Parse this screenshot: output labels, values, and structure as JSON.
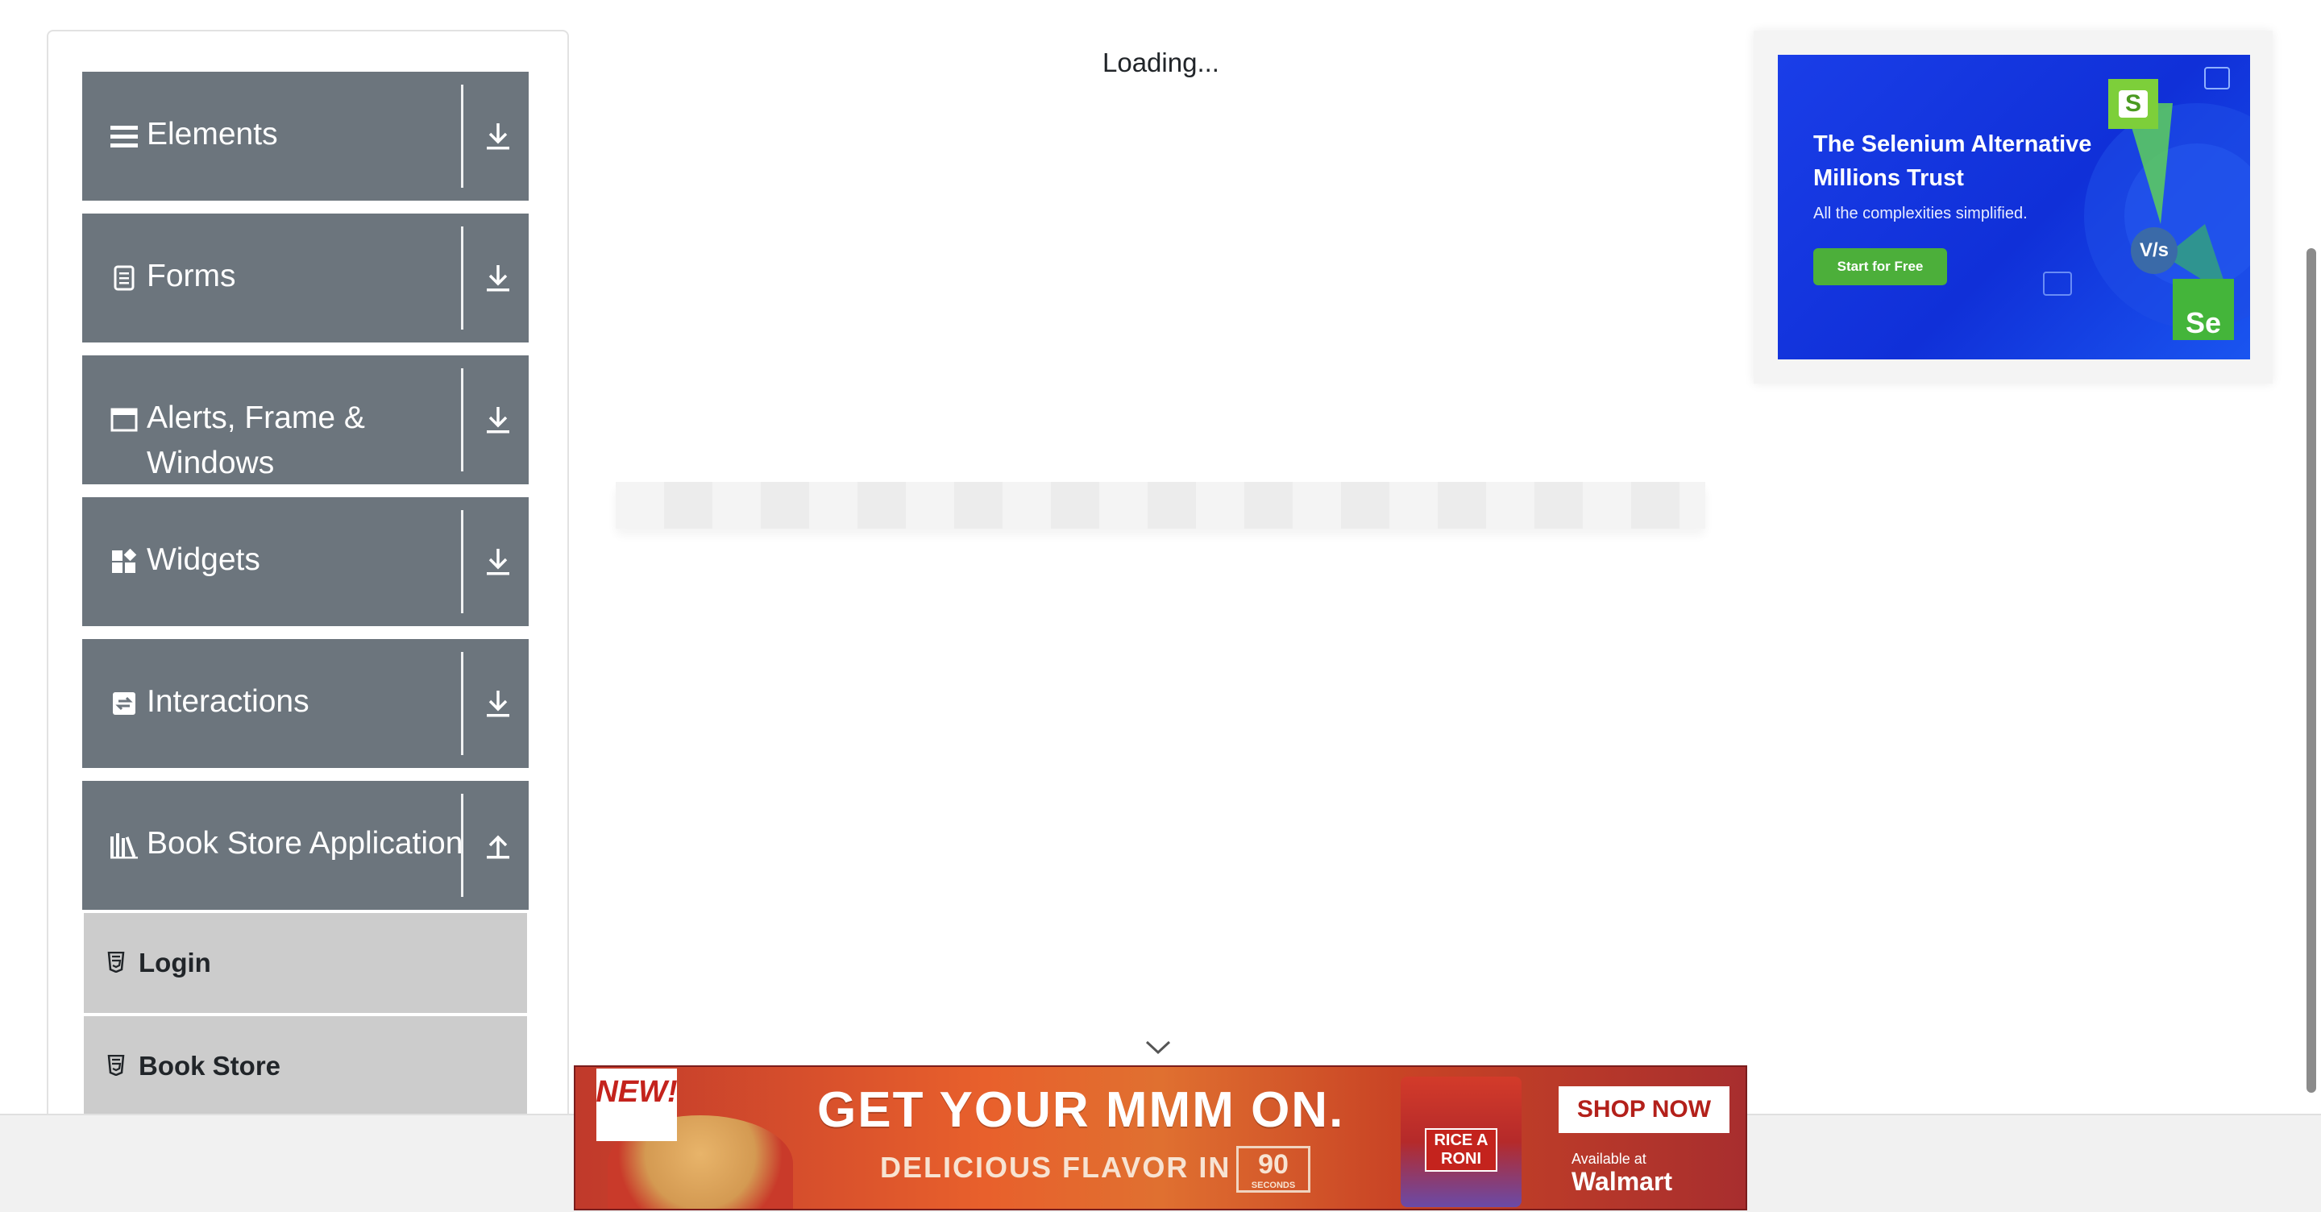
{
  "sidebar": {
    "groups": [
      {
        "title": "Elements",
        "icon": "hamburger-icon",
        "arrow": "download-arrow-icon"
      },
      {
        "title": "Forms",
        "icon": "document-icon",
        "arrow": "download-arrow-icon"
      },
      {
        "title": "Alerts, Frame & Windows",
        "icon": "window-icon",
        "arrow": "download-arrow-icon"
      },
      {
        "title": "Widgets",
        "icon": "widgets-icon",
        "arrow": "download-arrow-icon"
      },
      {
        "title": "Interactions",
        "icon": "interactions-icon",
        "arrow": "download-arrow-icon"
      },
      {
        "title": "Book Store Application",
        "icon": "books-icon",
        "arrow": "upload-arrow-icon"
      }
    ],
    "sub_items": [
      {
        "label": "Login",
        "icon": "html5-icon"
      },
      {
        "label": "Book Store",
        "icon": "html5-icon"
      }
    ]
  },
  "main": {
    "loading_text": "Loading..."
  },
  "right_ad": {
    "headline": "The Selenium Alternative Millions Trust",
    "subtext": "All the complexities simplified.",
    "cta": "Start for Free",
    "badge_s": "S",
    "vs": "V/s",
    "se": "Se"
  },
  "bottom_ad": {
    "new_tag": "NEW!",
    "headline": "GET YOUR MMM ON.",
    "subline": "DELICIOUS FLAVOR IN",
    "seconds_value": "90",
    "seconds_label": "SECONDS",
    "brand": "RICE A RONI",
    "cta": "SHOP NOW",
    "available_at": "Available at",
    "retailer": "Walmart"
  },
  "colors": {
    "group_header_bg": "#6c757d",
    "sub_item_bg": "#cccccc",
    "ad_blue": "#1a3ee8",
    "cta_green": "#4caf3a",
    "bottom_ad_red": "#c0392b"
  }
}
